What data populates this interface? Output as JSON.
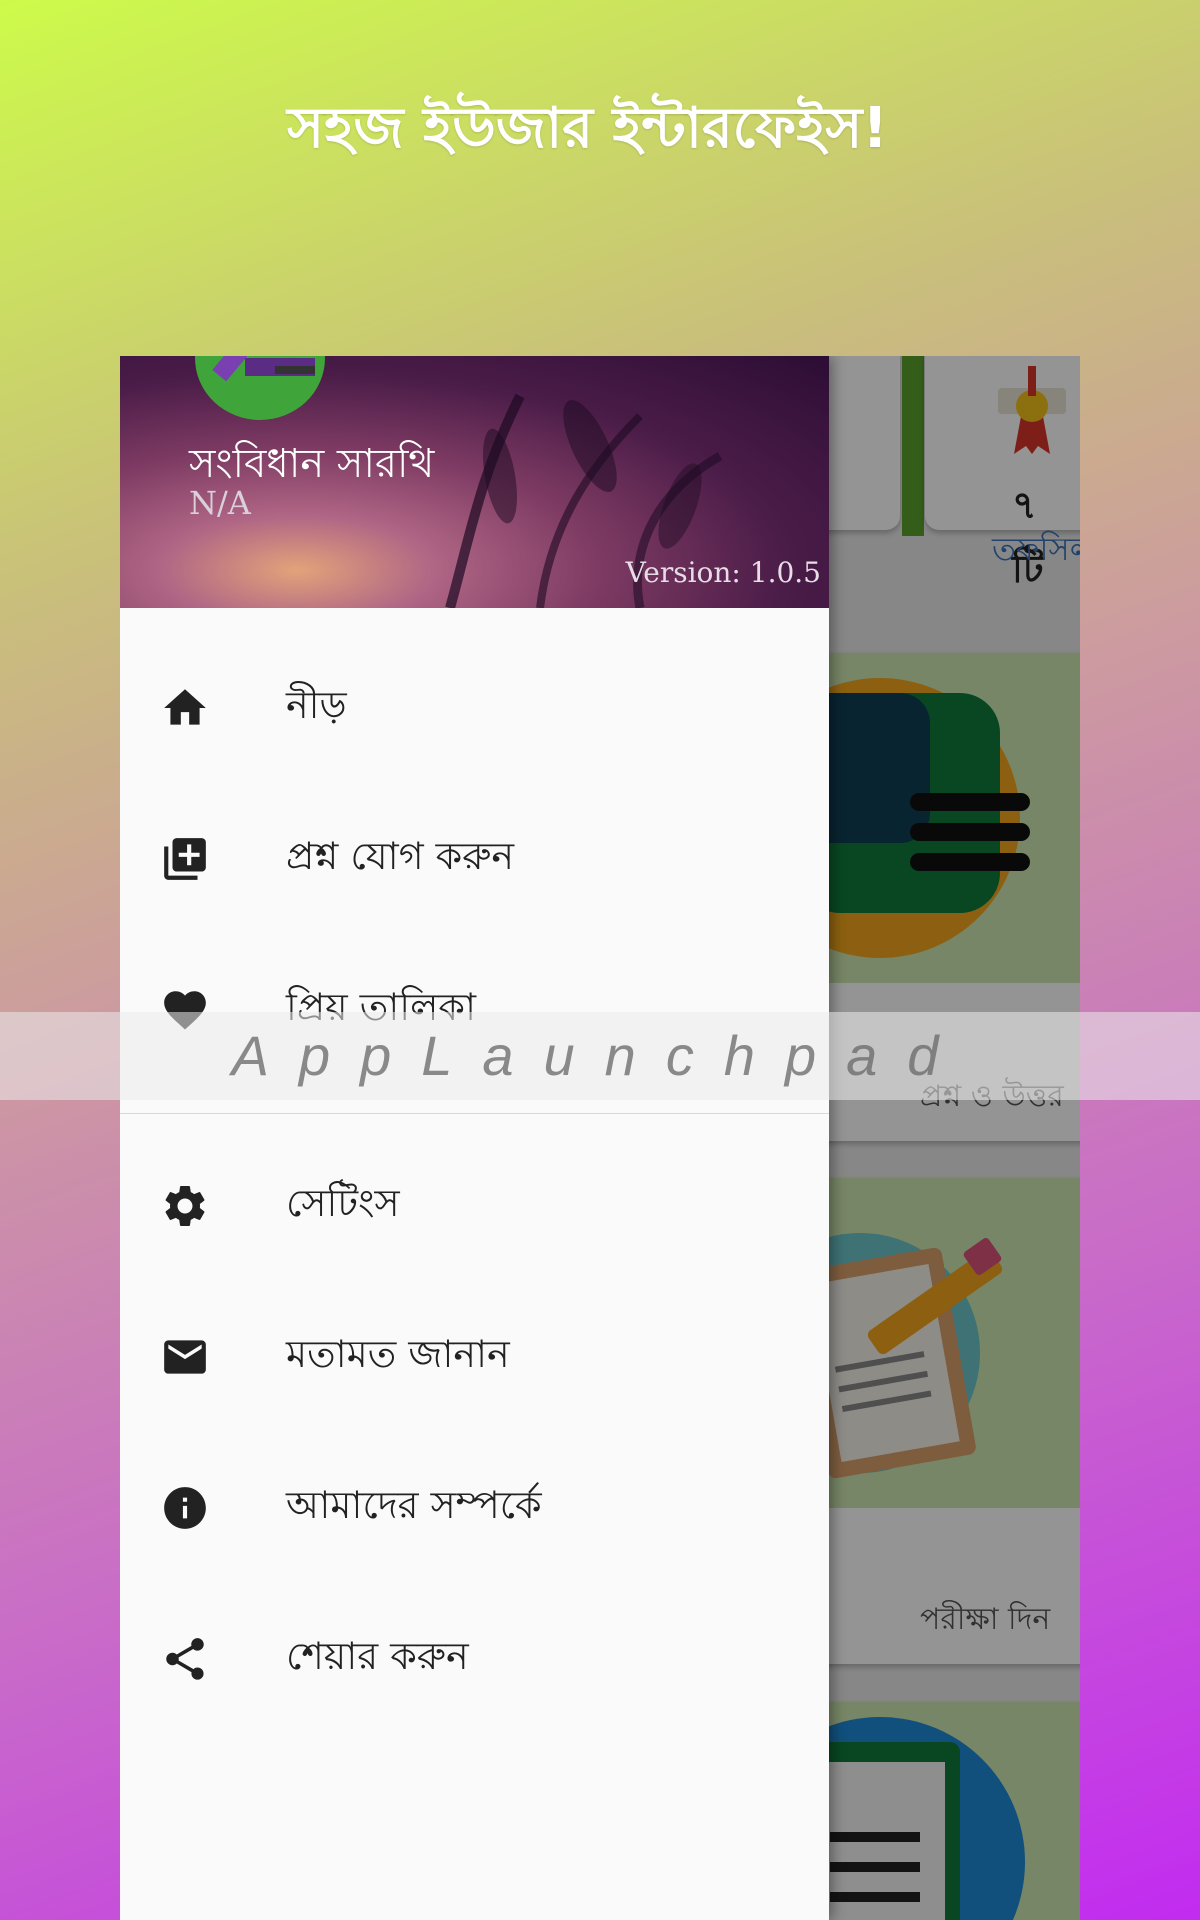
{
  "headline": "সহজ ইউজার ইন্টারফেইস!",
  "drawer": {
    "app_name": "সংবিধান সারথি",
    "subtitle": "N/A",
    "version": "Version: 1.0.5",
    "items": [
      {
        "label": "নীড়",
        "icon": "home-icon"
      },
      {
        "label": "প্রশ্ন যোগ করুন",
        "icon": "add-to-list-icon"
      },
      {
        "label": "প্রিয় তালিকা",
        "icon": "heart-icon"
      },
      {
        "label": "সেটিংস",
        "icon": "gear-icon"
      },
      {
        "label": "মতামত জানান",
        "icon": "mail-icon"
      },
      {
        "label": "আমাদের সম্পর্কে",
        "icon": "info-icon"
      },
      {
        "label": "শেয়ার করুন",
        "icon": "share-icon"
      }
    ]
  },
  "background": {
    "stat_count": "৭ টি",
    "stat_label": "তফসিল",
    "card_a_caption": "প্রশ্ন ও উত্তর",
    "card_b_caption": "পরীক্ষা দিন"
  },
  "watermark": "AppLaunchpad",
  "colors": {
    "accent_green": "#5aa02c",
    "label_blue": "#3b73b9"
  }
}
